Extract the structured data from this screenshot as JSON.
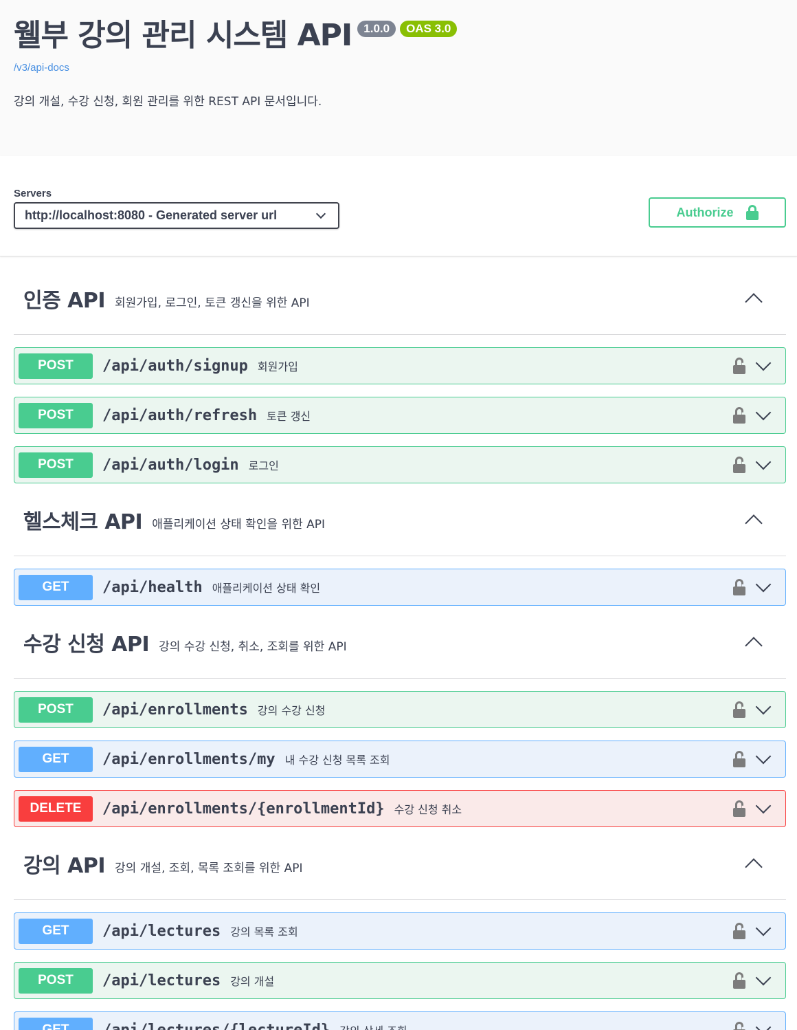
{
  "info": {
    "title": "웰부 강의 관리 시스템 API",
    "version": "1.0.0",
    "oas": "OAS 3.0",
    "docs_link": "/v3/api-docs",
    "description": "강의 개설, 수강 신청, 회원 관리를 위한 REST API 문서입니다."
  },
  "servers": {
    "label": "Servers",
    "selected": "http://localhost:8080 - Generated server url"
  },
  "authorize": {
    "label": "Authorize"
  },
  "tags": [
    {
      "name": "인증 API",
      "description": "회원가입, 로그인, 토큰 갱신을 위한 API",
      "operations": [
        {
          "method": "POST",
          "path": "/api/auth/signup",
          "summary": "회원가입"
        },
        {
          "method": "POST",
          "path": "/api/auth/refresh",
          "summary": "토큰 갱신"
        },
        {
          "method": "POST",
          "path": "/api/auth/login",
          "summary": "로그인"
        }
      ]
    },
    {
      "name": "헬스체크 API",
      "description": "애플리케이션 상태 확인을 위한 API",
      "operations": [
        {
          "method": "GET",
          "path": "/api/health",
          "summary": "애플리케이션 상태 확인"
        }
      ]
    },
    {
      "name": "수강 신청 API",
      "description": "강의 수강 신청, 취소, 조회를 위한 API",
      "operations": [
        {
          "method": "POST",
          "path": "/api/enrollments",
          "summary": "강의 수강 신청"
        },
        {
          "method": "GET",
          "path": "/api/enrollments/my",
          "summary": "내 수강 신청 목록 조회"
        },
        {
          "method": "DELETE",
          "path": "/api/enrollments/{enrollmentId}",
          "summary": "수강 신청 취소"
        }
      ]
    },
    {
      "name": "강의 API",
      "description": "강의 개설, 조회, 목록 조회를 위한 API",
      "operations": [
        {
          "method": "GET",
          "path": "/api/lectures",
          "summary": "강의 목록 조회"
        },
        {
          "method": "POST",
          "path": "/api/lectures",
          "summary": "강의 개설"
        },
        {
          "method": "GET",
          "path": "/api/lectures/{lectureId}",
          "summary": "강의 상세 조회"
        }
      ]
    }
  ]
}
